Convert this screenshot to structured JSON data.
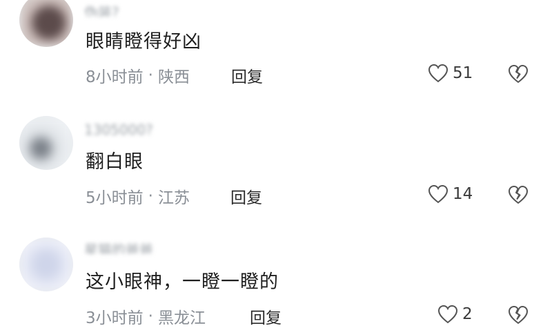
{
  "comments": [
    {
      "username": "伪装?",
      "text": "眼睛瞪得好凶",
      "time": "8小时前",
      "location": "陕西",
      "reply_label": "回复",
      "likes": "51",
      "avatar_colors": [
        "#c9b9b6",
        "#5c4b4b",
        "#d8d2cf"
      ]
    },
    {
      "username": "1305000?",
      "text": "翻白眼",
      "time": "5小时前",
      "location": "江苏",
      "reply_label": "回复",
      "likes": "14",
      "avatar_colors": [
        "#eef1f4",
        "#7a8088",
        "#dfe3e7"
      ]
    },
    {
      "username": "星猫的爸爸",
      "text": "这小眼神，一瞪一瞪的",
      "time": "3小时前",
      "location": "黑龙江",
      "reply_label": "回复",
      "likes": "2",
      "avatar_colors": [
        "#e7eaf6",
        "#cfd5ea",
        "#f2f3f8"
      ]
    }
  ],
  "meta_separator": "·",
  "icons": {
    "like": "heart-outline-icon",
    "dislike": "broken-heart-icon"
  }
}
